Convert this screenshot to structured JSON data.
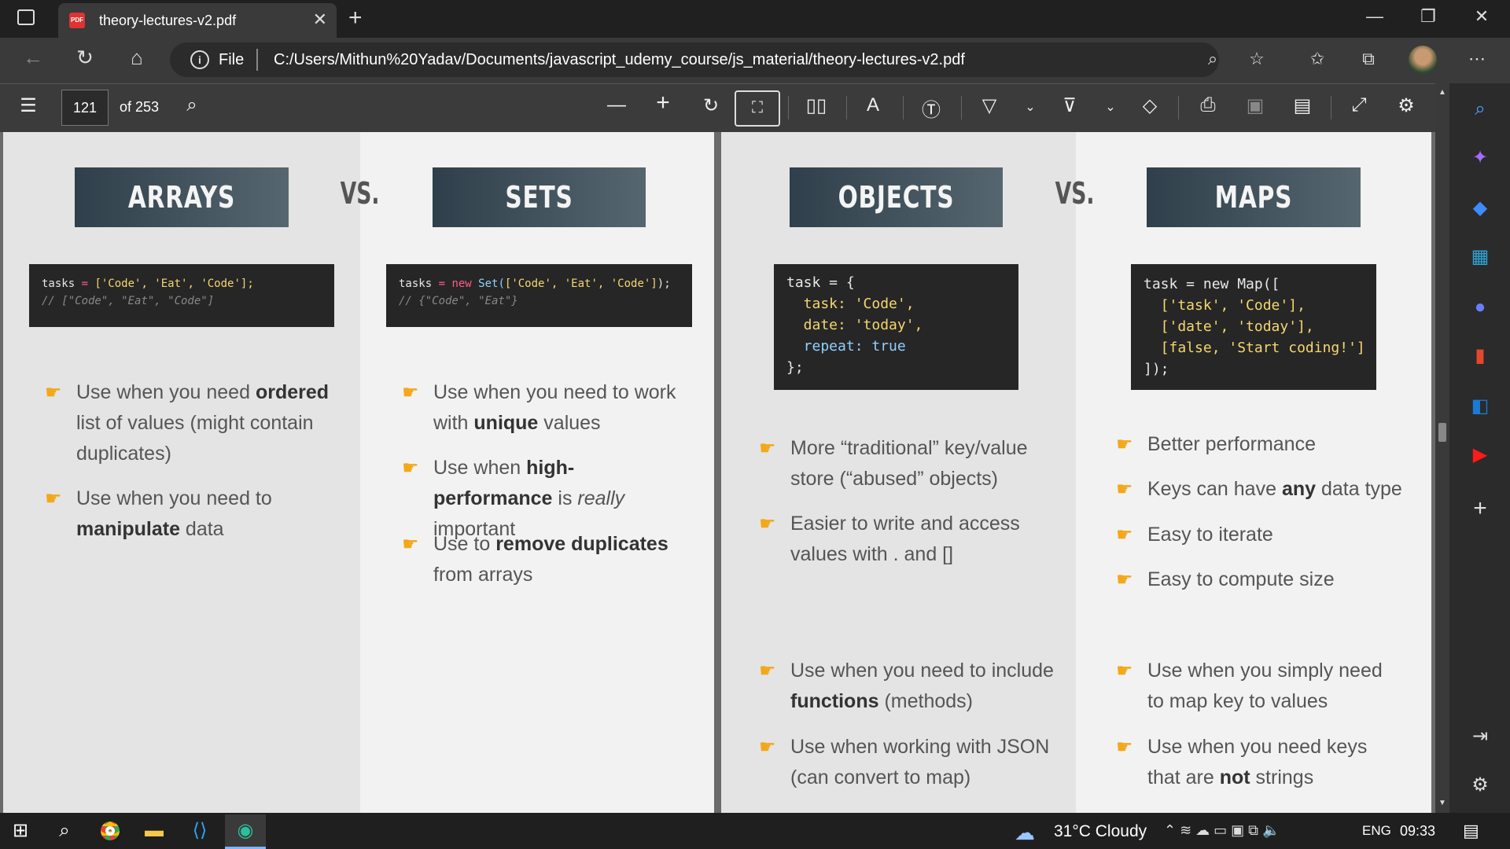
{
  "browser": {
    "tab_title": "theory-lectures-v2.pdf",
    "tab_icon_label": "PDF",
    "address_prefix": "File",
    "url": "C:/Users/Mithun%20Yadav/Documents/javascript_udemy_course/js_material/theory-lectures-v2.pdf"
  },
  "pdf_toolbar": {
    "page_number": "121",
    "page_total": "of 253"
  },
  "left_page": {
    "arrays_header": "ARRAYS",
    "vs": "VS.",
    "sets_header": "SETS",
    "arrays_code": {
      "line1_var": "tasks",
      "line1_op": " = ",
      "line1_val": "['Code', 'Eat', 'Code'];",
      "line2": "// [\"Code\", \"Eat\", \"Code\"]"
    },
    "sets_code": {
      "line1_var": "tasks",
      "line1_op": " = ",
      "line1_new": "new ",
      "line1_fn": "Set(",
      "line1_val": "['Code', 'Eat', 'Code']",
      "line1_end": ");",
      "line2": "// {\"Code\", \"Eat\"}"
    },
    "arrays_bullets": [
      {
        "pre": "Use when you need ",
        "bold": "ordered",
        "post": " list of values (might contain duplicates)"
      },
      {
        "pre": "Use when you need to ",
        "bold": "manipulate",
        "post": " data"
      }
    ],
    "sets_bullets": [
      {
        "pre": "Use when you need to work with ",
        "bold": "unique",
        "post": " values"
      },
      {
        "pre": "Use when ",
        "bold": "high-performance",
        "post": " is ",
        "italic": "really",
        "post2": " important"
      },
      {
        "pre": "Use to ",
        "bold": "remove duplicates",
        "post": " from arrays"
      }
    ]
  },
  "right_page": {
    "objects_header": "OBJECTS",
    "vs": "VS.",
    "maps_header": "MAPS",
    "objects_code": [
      "task = {",
      "  task: 'Code',",
      "  date: 'today',",
      "  repeat: true",
      "};"
    ],
    "maps_code": [
      "task = new Map([",
      "  ['task', 'Code'],",
      "  ['date', 'today'],",
      "  [false, 'Start coding!']",
      "]);"
    ],
    "objects_bullets_top": [
      {
        "text": "More “traditional” key/value store (“abused” objects)"
      },
      {
        "text": "Easier to write and access values with . and []"
      }
    ],
    "maps_bullets_top": [
      {
        "pre": "Better performance",
        "bold": "",
        "post": ""
      },
      {
        "pre": "Keys can have ",
        "bold": "any",
        "post": " data type"
      },
      {
        "pre": "Easy to iterate",
        "bold": "",
        "post": ""
      },
      {
        "pre": "Easy to compute size",
        "bold": "",
        "post": ""
      }
    ],
    "objects_bullets_bottom": [
      {
        "pre": "Use when you need to include ",
        "bold": "functions",
        "post": " (methods)"
      },
      {
        "pre": "Use when working with JSON (can convert to map)",
        "bold": "",
        "post": ""
      }
    ],
    "maps_bullets_bottom": [
      {
        "pre": "Use when you simply need to map key to values",
        "bold": "",
        "post": ""
      },
      {
        "pre": "Use when you need keys that are ",
        "bold": "not",
        "post": " strings"
      }
    ]
  },
  "taskbar": {
    "weather": "31°C  Cloudy",
    "language": "ENG",
    "time": "09:33"
  },
  "colors": {
    "header_box": "#3e4e5a",
    "code_bg": "#262626",
    "bullet_hand": "#f3a81a"
  }
}
